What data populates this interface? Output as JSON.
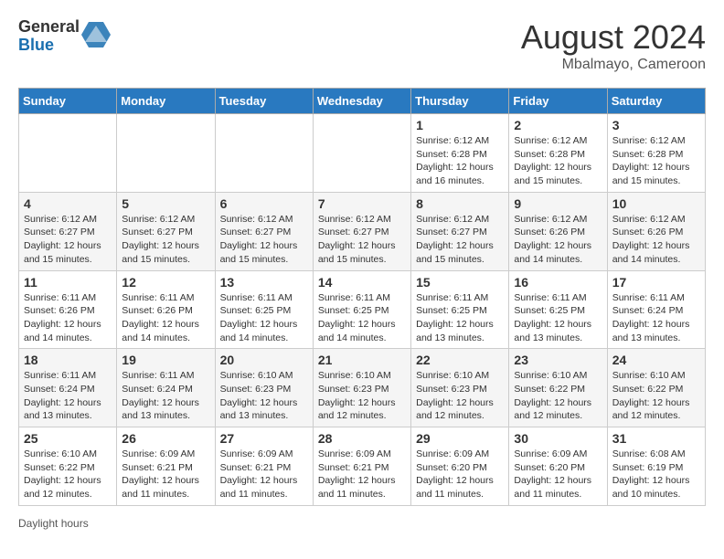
{
  "header": {
    "logo_general": "General",
    "logo_blue": "Blue",
    "month_year": "August 2024",
    "location": "Mbalmayo, Cameroon"
  },
  "days_of_week": [
    "Sunday",
    "Monday",
    "Tuesday",
    "Wednesday",
    "Thursday",
    "Friday",
    "Saturday"
  ],
  "weeks": [
    [
      {
        "day": "",
        "info": ""
      },
      {
        "day": "",
        "info": ""
      },
      {
        "day": "",
        "info": ""
      },
      {
        "day": "",
        "info": ""
      },
      {
        "day": "1",
        "info": "Sunrise: 6:12 AM\nSunset: 6:28 PM\nDaylight: 12 hours and 16 minutes."
      },
      {
        "day": "2",
        "info": "Sunrise: 6:12 AM\nSunset: 6:28 PM\nDaylight: 12 hours and 15 minutes."
      },
      {
        "day": "3",
        "info": "Sunrise: 6:12 AM\nSunset: 6:28 PM\nDaylight: 12 hours and 15 minutes."
      }
    ],
    [
      {
        "day": "4",
        "info": "Sunrise: 6:12 AM\nSunset: 6:27 PM\nDaylight: 12 hours and 15 minutes."
      },
      {
        "day": "5",
        "info": "Sunrise: 6:12 AM\nSunset: 6:27 PM\nDaylight: 12 hours and 15 minutes."
      },
      {
        "day": "6",
        "info": "Sunrise: 6:12 AM\nSunset: 6:27 PM\nDaylight: 12 hours and 15 minutes."
      },
      {
        "day": "7",
        "info": "Sunrise: 6:12 AM\nSunset: 6:27 PM\nDaylight: 12 hours and 15 minutes."
      },
      {
        "day": "8",
        "info": "Sunrise: 6:12 AM\nSunset: 6:27 PM\nDaylight: 12 hours and 15 minutes."
      },
      {
        "day": "9",
        "info": "Sunrise: 6:12 AM\nSunset: 6:26 PM\nDaylight: 12 hours and 14 minutes."
      },
      {
        "day": "10",
        "info": "Sunrise: 6:12 AM\nSunset: 6:26 PM\nDaylight: 12 hours and 14 minutes."
      }
    ],
    [
      {
        "day": "11",
        "info": "Sunrise: 6:11 AM\nSunset: 6:26 PM\nDaylight: 12 hours and 14 minutes."
      },
      {
        "day": "12",
        "info": "Sunrise: 6:11 AM\nSunset: 6:26 PM\nDaylight: 12 hours and 14 minutes."
      },
      {
        "day": "13",
        "info": "Sunrise: 6:11 AM\nSunset: 6:25 PM\nDaylight: 12 hours and 14 minutes."
      },
      {
        "day": "14",
        "info": "Sunrise: 6:11 AM\nSunset: 6:25 PM\nDaylight: 12 hours and 14 minutes."
      },
      {
        "day": "15",
        "info": "Sunrise: 6:11 AM\nSunset: 6:25 PM\nDaylight: 12 hours and 13 minutes."
      },
      {
        "day": "16",
        "info": "Sunrise: 6:11 AM\nSunset: 6:25 PM\nDaylight: 12 hours and 13 minutes."
      },
      {
        "day": "17",
        "info": "Sunrise: 6:11 AM\nSunset: 6:24 PM\nDaylight: 12 hours and 13 minutes."
      }
    ],
    [
      {
        "day": "18",
        "info": "Sunrise: 6:11 AM\nSunset: 6:24 PM\nDaylight: 12 hours and 13 minutes."
      },
      {
        "day": "19",
        "info": "Sunrise: 6:11 AM\nSunset: 6:24 PM\nDaylight: 12 hours and 13 minutes."
      },
      {
        "day": "20",
        "info": "Sunrise: 6:10 AM\nSunset: 6:23 PM\nDaylight: 12 hours and 13 minutes."
      },
      {
        "day": "21",
        "info": "Sunrise: 6:10 AM\nSunset: 6:23 PM\nDaylight: 12 hours and 12 minutes."
      },
      {
        "day": "22",
        "info": "Sunrise: 6:10 AM\nSunset: 6:23 PM\nDaylight: 12 hours and 12 minutes."
      },
      {
        "day": "23",
        "info": "Sunrise: 6:10 AM\nSunset: 6:22 PM\nDaylight: 12 hours and 12 minutes."
      },
      {
        "day": "24",
        "info": "Sunrise: 6:10 AM\nSunset: 6:22 PM\nDaylight: 12 hours and 12 minutes."
      }
    ],
    [
      {
        "day": "25",
        "info": "Sunrise: 6:10 AM\nSunset: 6:22 PM\nDaylight: 12 hours and 12 minutes."
      },
      {
        "day": "26",
        "info": "Sunrise: 6:09 AM\nSunset: 6:21 PM\nDaylight: 12 hours and 11 minutes."
      },
      {
        "day": "27",
        "info": "Sunrise: 6:09 AM\nSunset: 6:21 PM\nDaylight: 12 hours and 11 minutes."
      },
      {
        "day": "28",
        "info": "Sunrise: 6:09 AM\nSunset: 6:21 PM\nDaylight: 12 hours and 11 minutes."
      },
      {
        "day": "29",
        "info": "Sunrise: 6:09 AM\nSunset: 6:20 PM\nDaylight: 12 hours and 11 minutes."
      },
      {
        "day": "30",
        "info": "Sunrise: 6:09 AM\nSunset: 6:20 PM\nDaylight: 12 hours and 11 minutes."
      },
      {
        "day": "31",
        "info": "Sunrise: 6:08 AM\nSunset: 6:19 PM\nDaylight: 12 hours and 10 minutes."
      }
    ]
  ],
  "footer": {
    "daylight_label": "Daylight hours"
  }
}
